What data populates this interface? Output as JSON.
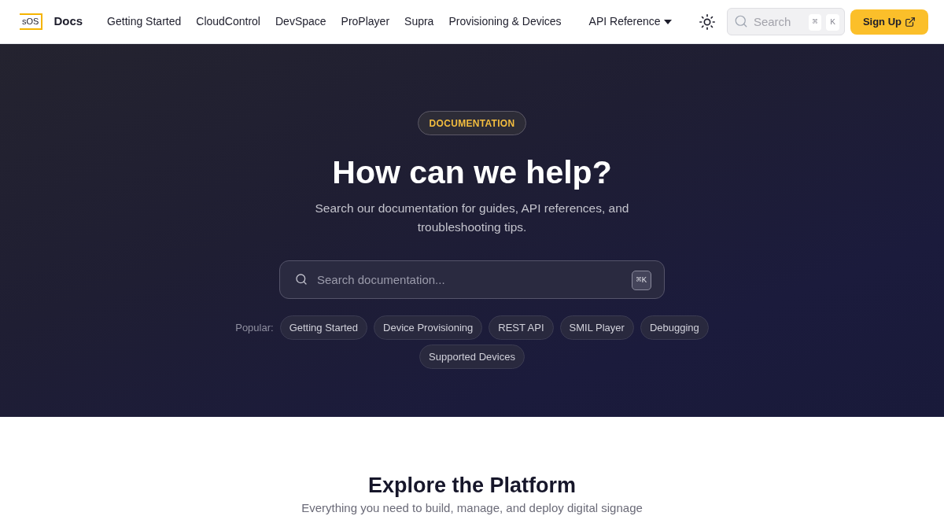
{
  "header": {
    "logo": "sOS",
    "title": "Docs",
    "nav": [
      {
        "label": "Getting Started",
        "kind": "link"
      },
      {
        "label": "CloudControl",
        "kind": "link"
      },
      {
        "label": "DevSpace",
        "kind": "link"
      },
      {
        "label": "ProPlayer",
        "kind": "link"
      },
      {
        "label": "Supra",
        "kind": "link"
      },
      {
        "label": "Provisioning & Devices",
        "kind": "link"
      },
      {
        "label": "API Reference",
        "kind": "dropdown"
      }
    ],
    "search": {
      "placeholder": "Search",
      "keys": [
        "⌘",
        "K"
      ]
    },
    "signup": "Sign Up"
  },
  "hero": {
    "badge": "DOCUMENTATION",
    "heading": "How can we help?",
    "subtitle": "Search our documentation for guides, API references, and troubleshooting tips.",
    "search": {
      "placeholder": "Search documentation...",
      "shortcut": "⌘K"
    },
    "popular_label": "Popular:",
    "popular": [
      "Getting Started",
      "Device Provisioning",
      "REST API",
      "SMIL Player",
      "Debugging",
      "Supported Devices"
    ]
  },
  "explore": {
    "heading": "Explore the Platform",
    "subtitle": "Everything you need to build, manage, and deploy digital signage"
  }
}
